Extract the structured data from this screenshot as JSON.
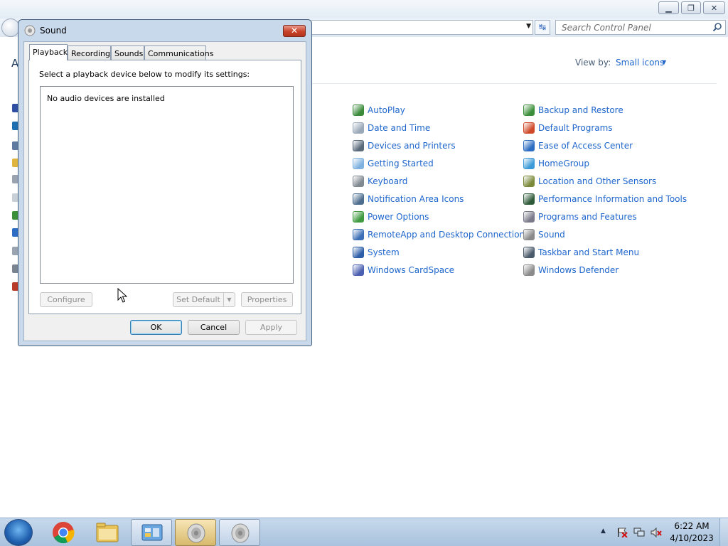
{
  "control_panel": {
    "search_placeholder": "Search Control Panel",
    "heading_letter": "A",
    "view_by_label": "View by:",
    "view_by_value": "Small icons",
    "items_col1": [
      {
        "label": "AutoPlay",
        "icon": "autoplay-icon",
        "color": "#3a8a3a"
      },
      {
        "label": "Date and Time",
        "icon": "clock-icon",
        "color": "#9aa8b8"
      },
      {
        "label": "Devices and Printers",
        "icon": "printer-icon",
        "color": "#5a6a7a"
      },
      {
        "label": "Getting Started",
        "icon": "getting-started-icon",
        "color": "#7fb2e0"
      },
      {
        "label": "Keyboard",
        "icon": "keyboard-icon",
        "color": "#808890"
      },
      {
        "label": "Notification Area Icons",
        "icon": "notification-area-icon",
        "color": "#4d6d8e"
      },
      {
        "label": "Power Options",
        "icon": "power-options-icon",
        "color": "#3f9a3f"
      },
      {
        "label": "RemoteApp and Desktop Connections",
        "icon": "remoteapp-icon",
        "color": "#3d6fb6"
      },
      {
        "label": "System",
        "icon": "system-icon",
        "color": "#2d5ea8"
      },
      {
        "label": "Windows CardSpace",
        "icon": "cardspace-icon",
        "color": "#4a5fb0"
      }
    ],
    "items_col2": [
      {
        "label": "Backup and Restore",
        "icon": "backup-restore-icon",
        "color": "#3b8f3b"
      },
      {
        "label": "Default Programs",
        "icon": "default-programs-icon",
        "color": "#d04a2a"
      },
      {
        "label": "Ease of Access Center",
        "icon": "ease-of-access-icon",
        "color": "#2c6cc2"
      },
      {
        "label": "HomeGroup",
        "icon": "homegroup-icon",
        "color": "#3c9ad8"
      },
      {
        "label": "Location and Other Sensors",
        "icon": "location-sensors-icon",
        "color": "#7a8a3a"
      },
      {
        "label": "Performance Information and Tools",
        "icon": "performance-icon",
        "color": "#2f5a3a"
      },
      {
        "label": "Programs and Features",
        "icon": "programs-features-icon",
        "color": "#7a7a8a"
      },
      {
        "label": "Sound",
        "icon": "speaker-icon",
        "color": "#8a8a8a"
      },
      {
        "label": "Taskbar and Start Menu",
        "icon": "taskbar-icon",
        "color": "#4a5a6a"
      },
      {
        "label": "Windows Defender",
        "icon": "windows-defender-icon",
        "color": "#8a8a8a"
      }
    ]
  },
  "sound_dialog": {
    "title": "Sound",
    "close_label": "✕",
    "tabs": [
      "Playback",
      "Recording",
      "Sounds",
      "Communications"
    ],
    "active_tab": "Playback",
    "instruction": "Select a playback device below to modify its settings:",
    "empty_message": "No audio devices are installed",
    "buttons": {
      "configure": "Configure",
      "set_default": "Set Default",
      "properties": "Properties",
      "ok": "OK",
      "cancel": "Cancel",
      "apply": "Apply"
    }
  },
  "taskbar": {
    "items": [
      "start-orb-icon",
      "chrome-icon",
      "windows-explorer-icon",
      "control-panel-icon",
      "sound-app-icon",
      "sound-app-icon"
    ],
    "clock_time": "6:22 AM",
    "clock_date": "4/10/2023"
  },
  "colors": {
    "link": "#1e66cc",
    "dialog_frame": "#c9d9ec",
    "close_button": "#c8432a"
  }
}
